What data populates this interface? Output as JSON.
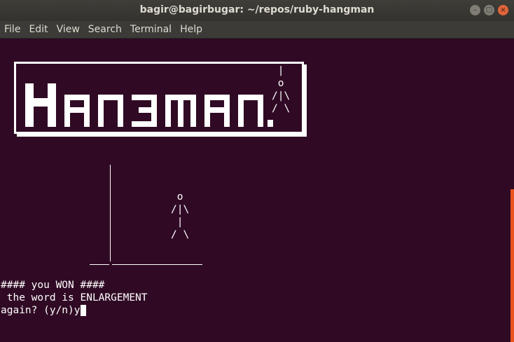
{
  "window": {
    "title": "bagir@bagirbugar: ~/repos/ruby-hangman",
    "controls": [
      "–",
      "□",
      "×"
    ]
  },
  "menubar": {
    "items": [
      "File",
      "Edit",
      "View",
      "Search",
      "Terminal",
      "Help"
    ]
  },
  "terminal": {
    "logo": {
      "text": "Hangman.",
      "figure_ascii": " |\n o\n/|\\\n/ \\"
    },
    "hangman_figure": " o\n/|\\\n |\n/ \\",
    "output": {
      "line1": "#### you WON ####",
      "line2": " the word is ENLARGEMENT",
      "prompt": "again? (y/n)",
      "input": "y"
    }
  },
  "colors": {
    "terminal_bg": "#300a24",
    "text": "#ffffff",
    "scroll_accent": "#e9541f"
  }
}
